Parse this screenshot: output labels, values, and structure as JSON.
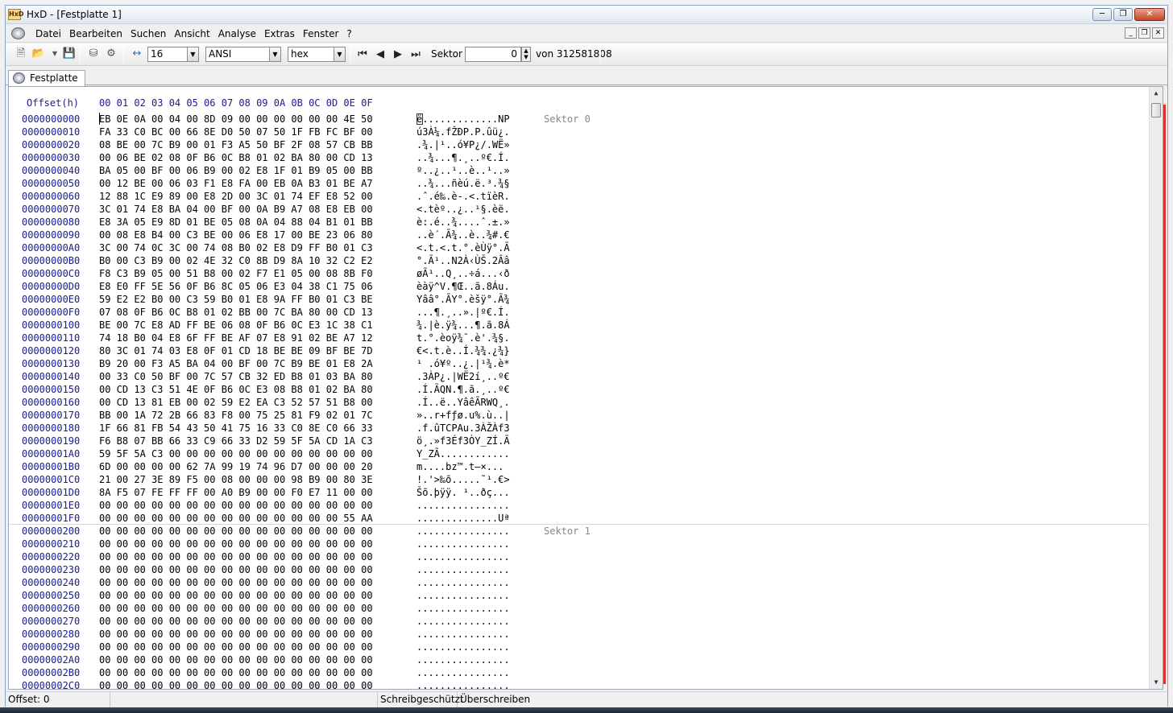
{
  "window": {
    "title": "HxD - [Festplatte 1]"
  },
  "menu": [
    "Datei",
    "Bearbeiten",
    "Suchen",
    "Ansicht",
    "Analyse",
    "Extras",
    "Fenster",
    "?"
  ],
  "toolbar": {
    "bytes_per_row": "16",
    "charset": "ANSI",
    "offset_base": "hex",
    "sector_label": "Sektor",
    "sector_value": "0",
    "sector_total": "von 312581808"
  },
  "tab": {
    "label": "Festplatte 1"
  },
  "editor": {
    "offset_header": "Offset(h)",
    "column_header": "00 01 02 03 04 05 06 07 08 09 0A 0B 0C 0D 0E 0F",
    "rows": [
      {
        "o": "0000000000",
        "h": "EB 0E 0A 00 04 00 8D 09 00 00 00 00 00 00 4E 50",
        "t": "ë.............NP"
      },
      {
        "o": "0000000010",
        "h": "FA 33 C0 BC 00 66 8E D0 50 07 50 1F FB FC BF 00",
        "t": "ú3À¼.fŽÐP.P.ûü¿."
      },
      {
        "o": "0000000020",
        "h": "08 BE 00 7C B9 00 01 F3 A5 50 BF 2F 08 57 CB BB",
        "t": ".¾.|¹..ó¥P¿/.WË»"
      },
      {
        "o": "0000000030",
        "h": "00 06 BE 02 08 0F B6 0C B8 01 02 BA 80 00 CD 13",
        "t": "..¾...¶.¸..º€.Í."
      },
      {
        "o": "0000000040",
        "h": "BA 05 00 BF 00 06 B9 00 02 E8 1F 01 B9 05 00 BB",
        "t": "º..¿..¹..è..¹..»"
      },
      {
        "o": "0000000050",
        "h": "00 12 BE 00 06 03 F1 E8 FA 00 EB 0A B3 01 BE A7",
        "t": "..¾...ñèú.ë.³.¾§"
      },
      {
        "o": "0000000060",
        "h": "12 88 1C E9 89 00 E8 2D 00 3C 01 74 EF E8 52 00",
        "t": ".ˆ.é‰.è-.<.tïèR."
      },
      {
        "o": "0000000070",
        "h": "3C 01 74 E8 BA 04 00 BF 00 0A B9 A7 08 E8 EB 00",
        "t": "<.tèº..¿..¹§.èë."
      },
      {
        "o": "0000000080",
        "h": "E8 3A 05 E9 8D 01 BE 05 08 0A 04 88 04 B1 01 BB",
        "t": "è:.é..¾....ˆ.±.»"
      },
      {
        "o": "0000000090",
        "h": "00 08 E8 B4 00 C3 BE 00 06 E8 17 00 BE 23 06 80",
        "t": "..è´.Ã¾..è..¾#.€"
      },
      {
        "o": "00000000A0",
        "h": "3C 00 74 0C 3C 00 74 08 B0 02 E8 D9 FF B0 01 C3",
        "t": "<.t.<.t.°.èÙÿ°.Ã"
      },
      {
        "o": "00000000B0",
        "h": "B0 00 C3 B9 00 02 4E 32 C0 8B D9 8A 10 32 C2 E2",
        "t": "°.Ã¹..N2À‹ÙŠ.2Ââ"
      },
      {
        "o": "00000000C0",
        "h": "F8 C3 B9 05 00 51 B8 00 02 F7 E1 05 00 08 8B F0",
        "t": "øÃ¹..Q¸..÷á...‹ð"
      },
      {
        "o": "00000000D0",
        "h": "E8 E0 FF 5E 56 0F B6 8C 05 06 E3 04 38 C1 75 06",
        "t": "èàÿ^V.¶Œ..ã.8Áu."
      },
      {
        "o": "00000000E0",
        "h": "59 E2 E2 B0 00 C3 59 B0 01 E8 9A FF B0 01 C3 BE",
        "t": "Yââ°.ÃY°.èšÿ°.Ã¾"
      },
      {
        "o": "00000000F0",
        "h": "07 08 0F B6 0C B8 01 02 BB 00 7C BA 80 00 CD 13",
        "t": "...¶.¸..».|º€.Í."
      },
      {
        "o": "0000000100",
        "h": "BE 00 7C E8 AD FF BE 06 08 0F B6 0C E3 1C 38 C1",
        "t": "¾.|è.ÿ¾...¶.ã.8Á"
      },
      {
        "o": "0000000110",
        "h": "74 18 B0 04 E8 6F FF BE AF 07 E8 91 02 BE A7 12",
        "t": "t.°.èoÿ¾¯.è'.¾§."
      },
      {
        "o": "0000000120",
        "h": "80 3C 01 74 03 E8 0F 01 CD 18 BE BE 09 BF BE 7D",
        "t": "€<.t.è..Í.¾¾.¿¾}"
      },
      {
        "o": "0000000130",
        "h": "B9 20 00 F3 A5 BA 04 00 BF 00 7C B9 BE 01 E8 2A",
        "t": "¹ .ó¥º..¿.|¹¾.è*"
      },
      {
        "o": "0000000140",
        "h": "00 33 C0 50 BF 00 7C 57 CB 32 ED B8 01 03 BA 80",
        "t": ".3ÀP¿.|WË2í¸..º€"
      },
      {
        "o": "0000000150",
        "h": "00 CD 13 C3 51 4E 0F B6 0C E3 08 B8 01 02 BA 80",
        "t": ".Í.ÃQN.¶.ã.¸..º€"
      },
      {
        "o": "0000000160",
        "h": "00 CD 13 81 EB 00 02 59 E2 EA C3 52 57 51 B8 00",
        "t": ".Í..ë..YâêÃRWQ¸."
      },
      {
        "o": "0000000170",
        "h": "BB 00 1A 72 2B 66 83 F8 00 75 25 81 F9 02 01 7C",
        "t": "»..r+fƒø.u%.ù..|"
      },
      {
        "o": "0000000180",
        "h": "1F 66 81 FB 54 43 50 41 75 16 33 C0 8E C0 66 33",
        "t": ".f.ûTCPAu.3ÀŽÀf3"
      },
      {
        "o": "0000000190",
        "h": "F6 B8 07 BB 66 33 C9 66 33 D2 59 5F 5A CD 1A C3",
        "t": "ö¸.»f3Éf3ÒY_ZÍ.Ã"
      },
      {
        "o": "00000001A0",
        "h": "59 5F 5A C3 00 00 00 00 00 00 00 00 00 00 00 00",
        "t": "Y_ZÃ............"
      },
      {
        "o": "00000001B0",
        "h": "6D 00 00 00 00 62 7A 99 19 74 96 D7 00 00 00 20",
        "t": "m....bz™.t–×... "
      },
      {
        "o": "00000001C0",
        "h": "21 00 27 3E 89 F5 00 08 00 00 00 98 B9 00 80 3E",
        "t": "!.'>‰õ.....˜¹.€>"
      },
      {
        "o": "00000001D0",
        "h": "8A F5 07 FE FF FF 00 A0 B9 00 00 F0 E7 11 00 00",
        "t": "Šõ.þÿÿ. ¹..ðç..."
      },
      {
        "o": "00000001E0",
        "h": "00 00 00 00 00 00 00 00 00 00 00 00 00 00 00 00",
        "t": "................"
      },
      {
        "o": "00000001F0",
        "h": "00 00 00 00 00 00 00 00 00 00 00 00 00 00 55 AA",
        "t": "..............Uª"
      },
      {
        "o": "0000000200",
        "h": "00 00 00 00 00 00 00 00 00 00 00 00 00 00 00 00",
        "t": "................"
      },
      {
        "o": "0000000210",
        "h": "00 00 00 00 00 00 00 00 00 00 00 00 00 00 00 00",
        "t": "................"
      },
      {
        "o": "0000000220",
        "h": "00 00 00 00 00 00 00 00 00 00 00 00 00 00 00 00",
        "t": "................"
      },
      {
        "o": "0000000230",
        "h": "00 00 00 00 00 00 00 00 00 00 00 00 00 00 00 00",
        "t": "................"
      },
      {
        "o": "0000000240",
        "h": "00 00 00 00 00 00 00 00 00 00 00 00 00 00 00 00",
        "t": "................"
      },
      {
        "o": "0000000250",
        "h": "00 00 00 00 00 00 00 00 00 00 00 00 00 00 00 00",
        "t": "................"
      },
      {
        "o": "0000000260",
        "h": "00 00 00 00 00 00 00 00 00 00 00 00 00 00 00 00",
        "t": "................"
      },
      {
        "o": "0000000270",
        "h": "00 00 00 00 00 00 00 00 00 00 00 00 00 00 00 00",
        "t": "................"
      },
      {
        "o": "0000000280",
        "h": "00 00 00 00 00 00 00 00 00 00 00 00 00 00 00 00",
        "t": "................"
      },
      {
        "o": "0000000290",
        "h": "00 00 00 00 00 00 00 00 00 00 00 00 00 00 00 00",
        "t": "................"
      },
      {
        "o": "00000002A0",
        "h": "00 00 00 00 00 00 00 00 00 00 00 00 00 00 00 00",
        "t": "................"
      },
      {
        "o": "00000002B0",
        "h": "00 00 00 00 00 00 00 00 00 00 00 00 00 00 00 00",
        "t": "................"
      },
      {
        "o": "00000002C0",
        "h": "00 00 00 00 00 00 00 00 00 00 00 00 00 00 00 00",
        "t": "................"
      }
    ],
    "sectors": [
      {
        "label": "Sektor 0",
        "row": 0
      },
      {
        "label": "Sektor 1",
        "row": 32
      }
    ]
  },
  "status": {
    "offset": "Offset: 0",
    "readonly": "Schreibgeschützt",
    "mode": "Überschreiben"
  }
}
